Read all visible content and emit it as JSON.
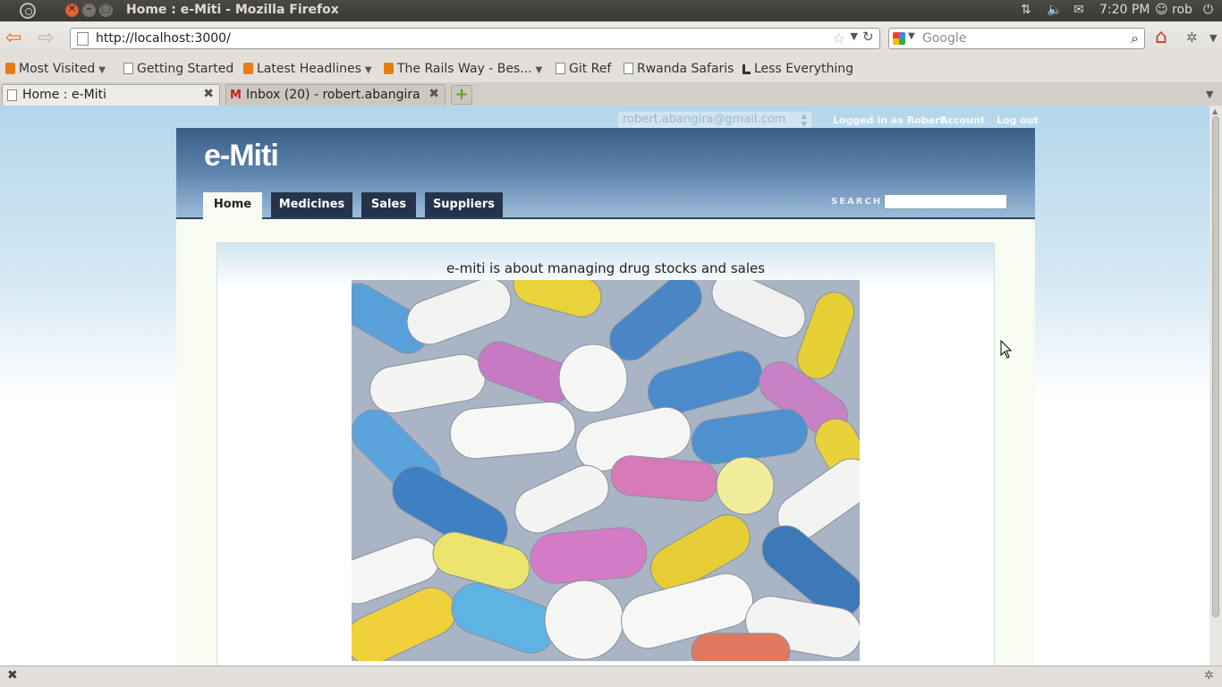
{
  "os": {
    "window_title": "Home : e-Miti - Mozilla Firefox",
    "tray": {
      "clock": "7:20 PM",
      "user": "rob"
    }
  },
  "browser": {
    "url": "http://localhost:3000/",
    "search_placeholder": "Google",
    "bookmarks": [
      {
        "label": "Most Visited",
        "icon": "folder-icon",
        "dropdown": true
      },
      {
        "label": "Getting Started",
        "icon": "page-icon",
        "dropdown": false
      },
      {
        "label": "Latest Headlines",
        "icon": "rss-icon",
        "dropdown": true
      },
      {
        "label": "The Rails Way - Bes...",
        "icon": "rss-icon",
        "dropdown": true
      },
      {
        "label": "Git Ref",
        "icon": "page-icon",
        "dropdown": false
      },
      {
        "label": "Rwanda Safaris",
        "icon": "page-icon",
        "dropdown": false
      },
      {
        "label": "Less Everything",
        "icon": "less-everything-icon",
        "dropdown": false
      }
    ],
    "tabs": [
      {
        "label": "Home : e-Miti",
        "active": true
      },
      {
        "label": "Inbox (20) - robert.abangira...",
        "active": false
      }
    ]
  },
  "page": {
    "user_select_value": "robert.abangira@gmail.com",
    "user_links": {
      "logged_in": "Logged in as Robert",
      "account": "Account",
      "logout": "Log out"
    },
    "logo": "e-Miti",
    "nav": [
      {
        "label": "Home",
        "active": true
      },
      {
        "label": "Medicines",
        "active": false
      },
      {
        "label": "Sales",
        "active": false
      },
      {
        "label": "Suppliers",
        "active": false
      }
    ],
    "search_label": "SEARCH",
    "tagline": "e-miti is about managing drug stocks and sales"
  },
  "colors": {
    "header_top": "#3a5e88",
    "nav_tab": "#25344b",
    "page_bg_top": "#b4d6ea",
    "content_bg": "#f8fbf2"
  }
}
